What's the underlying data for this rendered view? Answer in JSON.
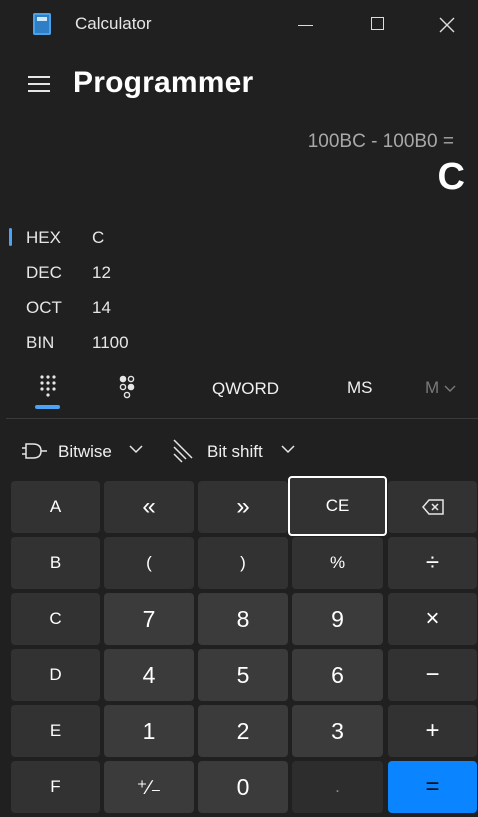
{
  "window": {
    "title": "Calculator"
  },
  "header": {
    "mode_title": "Programmer"
  },
  "display": {
    "expression": "100BC - 100B0 =",
    "result": "C"
  },
  "radix": [
    {
      "name": "HEX",
      "value": "C",
      "selected": true
    },
    {
      "name": "DEC",
      "value": "12",
      "selected": false
    },
    {
      "name": "OCT",
      "value": "14",
      "selected": false
    },
    {
      "name": "BIN",
      "value": "1100",
      "selected": false
    }
  ],
  "toolbar": {
    "word_size": "QWORD",
    "memory_store": "MS",
    "memory_menu": "M"
  },
  "dropdowns": {
    "bitwise": "Bitwise",
    "bitshift": "Bit shift"
  },
  "keys": {
    "A": "A",
    "lsh": "«",
    "rsh": "»",
    "CE": "CE",
    "B": "B",
    "lparen": "(",
    "rparen": ")",
    "percent": "%",
    "divide": "÷",
    "C": "C",
    "seven": "7",
    "eight": "8",
    "nine": "9",
    "multiply": "×",
    "D": "D",
    "four": "4",
    "five": "5",
    "six": "6",
    "minus": "−",
    "E": "E",
    "one": "1",
    "two": "2",
    "three": "3",
    "plus": "+",
    "F": "F",
    "negate": "⁺∕₋",
    "zero": "0",
    "decimal": ".",
    "equals": "="
  },
  "colors": {
    "accent": "#0a84ff",
    "background": "#202020",
    "key": "#3b3b3b"
  }
}
